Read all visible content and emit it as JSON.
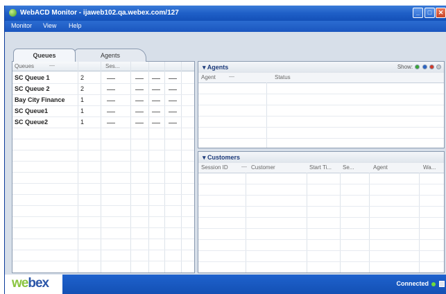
{
  "window": {
    "title": "WebACD Monitor - ijaweb102.qa.webex.com/127",
    "controls": [
      "minimize-icon",
      "maximize-icon",
      "close-icon"
    ]
  },
  "menu": [
    "Monitor",
    "View",
    "Help"
  ],
  "tabs": [
    {
      "label": "Queues",
      "active": true
    },
    {
      "label": "Agents",
      "active": false
    }
  ],
  "queues": {
    "columns": [
      "Queues",
      "Ses..."
    ],
    "rows": [
      {
        "name": "SC Queue 1",
        "count": "2"
      },
      {
        "name": "SC Queue 2",
        "count": "2"
      },
      {
        "name": "Bay City Finance",
        "count": "1"
      },
      {
        "name": "SC Queue1",
        "count": "1"
      },
      {
        "name": "SC Queue2",
        "count": "1"
      }
    ],
    "empty_value": "—"
  },
  "agents": {
    "title": "Agents",
    "show_label": "Show:",
    "show_dot_colors": [
      "#3aa635",
      "#2b64c4",
      "#d23a2a",
      "#c8c8c8"
    ],
    "columns": [
      "Agent",
      "Status"
    ]
  },
  "customers": {
    "title": "Customers",
    "columns": [
      "Session ID",
      "Customer",
      "Start Ti...",
      "Se...",
      "Agent",
      "Wa..."
    ]
  },
  "status": {
    "logo_we": "we",
    "logo_bex": "bex",
    "connected": "Connected"
  }
}
